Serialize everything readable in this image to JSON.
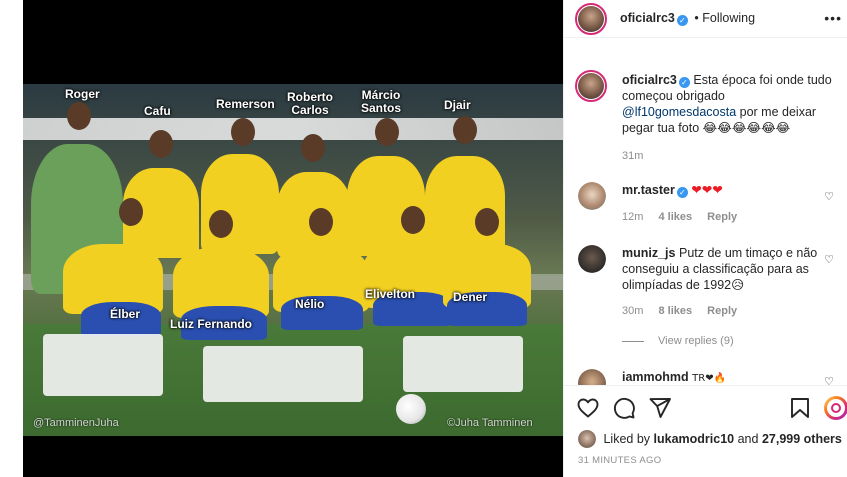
{
  "post": {
    "author": "oficialrc3",
    "follow_state": "Following",
    "separator": "•",
    "more_icon": "•••"
  },
  "photo": {
    "names": {
      "roger": "Roger",
      "cafu": "Cafu",
      "remerson": "Remerson",
      "roberto_carlos": "Roberto\nCarlos",
      "marcio_santos": "Márcio\nSantos",
      "djair": "Djair",
      "elber": "Élber",
      "luiz_fernando": "Luiz Fernando",
      "nelio": "Nélio",
      "elivelton": "Elivelton",
      "dener": "Dener"
    },
    "watermark_left": "@TamminenJuha",
    "watermark_right": "©Juha Tamminen"
  },
  "caption": {
    "username": "oficialrc3",
    "text": "Esta época foi onde tudo começou obrigado",
    "mention": "@lf10gomesdacosta",
    "text_after": "por me deixar pegar tua foto",
    "emojis": "😂😂😂😂😂😂",
    "time": "31m"
  },
  "comments": [
    {
      "username": "mr.taster",
      "text": "❤❤❤",
      "time": "12m",
      "likes": "4 likes",
      "reply": "Reply"
    },
    {
      "username": "muniz_js",
      "text": "Putz de um timaço e não conseguiu a classificação para as olimpíadas de 1992",
      "emoji": "😥",
      "time": "30m",
      "likes": "8 likes",
      "reply": "Reply",
      "view_replies": "View replies (9)"
    },
    {
      "username": "iammohmd",
      "text": "TR❤🔥"
    }
  ],
  "footer": {
    "liked_by_prefix": "Liked by",
    "liked_by_user": "lukamodric10",
    "liked_by_suffix": "and",
    "liked_by_others": "27,999 others",
    "timestamp": "31 MINUTES AGO"
  },
  "colors": {
    "verified": "#3897f0",
    "link": "#00376b",
    "muted": "#8e8e8e",
    "story_ring": "#d62976"
  }
}
